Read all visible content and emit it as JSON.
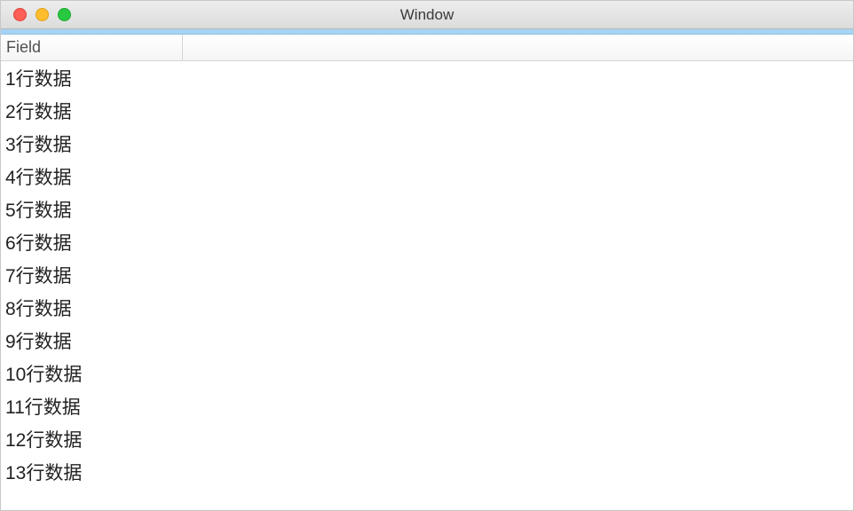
{
  "window": {
    "title": "Window"
  },
  "table": {
    "header": {
      "field_label": "Field"
    },
    "rows": [
      {
        "label": "1行数据"
      },
      {
        "label": "2行数据"
      },
      {
        "label": "3行数据"
      },
      {
        "label": "4行数据"
      },
      {
        "label": "5行数据"
      },
      {
        "label": "6行数据"
      },
      {
        "label": "7行数据"
      },
      {
        "label": "8行数据"
      },
      {
        "label": "9行数据"
      },
      {
        "label": "10行数据"
      },
      {
        "label": "11行数据"
      },
      {
        "label": "12行数据"
      },
      {
        "label": "13行数据"
      }
    ]
  }
}
